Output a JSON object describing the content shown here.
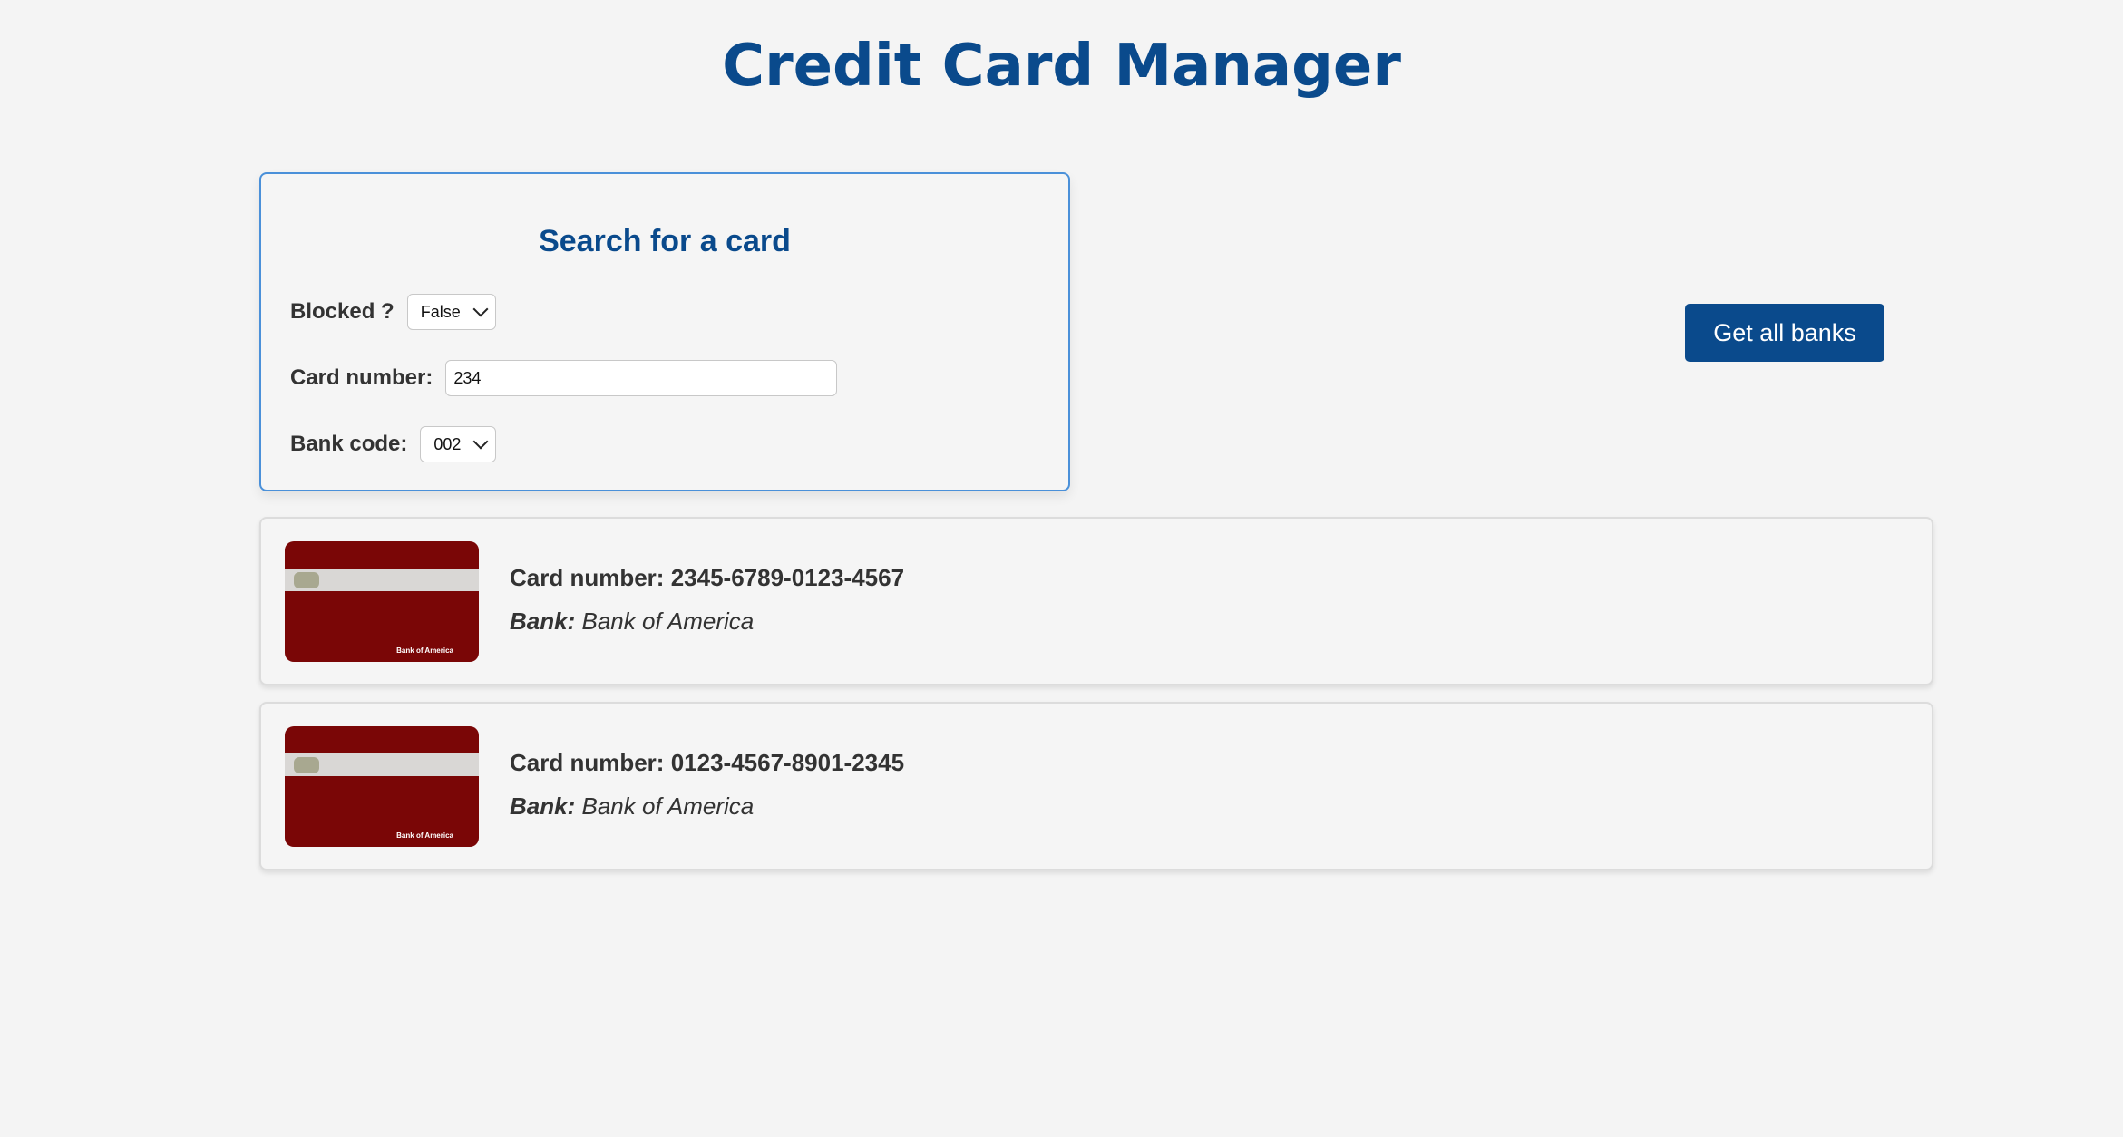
{
  "header": {
    "title": "Credit Card Manager"
  },
  "search": {
    "title": "Search for a card",
    "blocked_label": "Blocked ?",
    "blocked_value": "False",
    "card_number_label": "Card number:",
    "card_number_value": "234",
    "bank_code_label": "Bank code:",
    "bank_code_value": "002"
  },
  "actions": {
    "get_all_banks_label": "Get all banks"
  },
  "cards": [
    {
      "card_number_label": "Card number:",
      "card_number": "2345-6789-0123-4567",
      "bank_label": "Bank:",
      "bank_name": "Bank of America",
      "image_bank_text": "Bank of America"
    },
    {
      "card_number_label": "Card number:",
      "card_number": "0123-4567-8901-2345",
      "bank_label": "Bank:",
      "bank_name": "Bank of America",
      "image_bank_text": "Bank of America"
    }
  ],
  "colors": {
    "brand": "#0a4a8c",
    "card_body": "#7a0606",
    "panel_border": "#4a90d9",
    "background": "#f4f4f4"
  }
}
